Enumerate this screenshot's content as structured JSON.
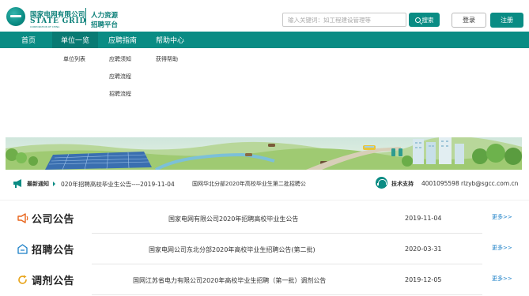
{
  "brand": {
    "cn_name": "国家电网有限公司",
    "en_name": "STATE GRID",
    "en_sub": "CORPORATION OF CHINA",
    "sub_line1": "人力资源",
    "sub_line2": "招聘平台"
  },
  "search": {
    "placeholder": "输入关键词：如工程建设管理等",
    "button_label": "搜索"
  },
  "auth": {
    "login": "登录",
    "register": "注册"
  },
  "nav": {
    "items": [
      {
        "label": "首页"
      },
      {
        "label": "单位一览"
      },
      {
        "label": "应聘指南"
      },
      {
        "label": "帮助中心"
      }
    ]
  },
  "dropdown": {
    "unit_list": "单位列表",
    "guide": [
      "应聘须知",
      "应聘流程",
      "招聘流程"
    ],
    "help": "获得帮助"
  },
  "notice": {
    "label": "最新通知",
    "item1": "020年招聘高校毕业生公告----2019-11-04",
    "item2": "国网华北分部2020年高校毕业生第二批招聘公"
  },
  "support": {
    "label": "技术支持",
    "phone": "4001095598",
    "email": "rlzyb@sgcc.com.cn"
  },
  "announcements": [
    {
      "title": "公司公告",
      "icon": "megaphone-icon",
      "item": "国家电网有限公司2020年招聘高校毕业生公告",
      "date": "2019-11-04",
      "more": "更多>>"
    },
    {
      "title": "招聘公告",
      "icon": "inbox-icon",
      "item": "国家电网公司东北分部2020年高校毕业生招聘公告(第二批)",
      "date": "2020-03-31",
      "more": "更多>>"
    },
    {
      "title": "调剂公告",
      "icon": "refresh-icon",
      "item": "国网江苏省电力有限公司2020年高校毕业生招聘（第一批）调剂公告",
      "date": "2019-12-05",
      "more": "更多>>"
    }
  ],
  "colors": {
    "brand_green": "#0a8c84",
    "nav_active": "#087a73",
    "icon_orange": "#e8641b",
    "icon_blue": "#1a7fc7",
    "link_blue": "#1a7fc7"
  }
}
